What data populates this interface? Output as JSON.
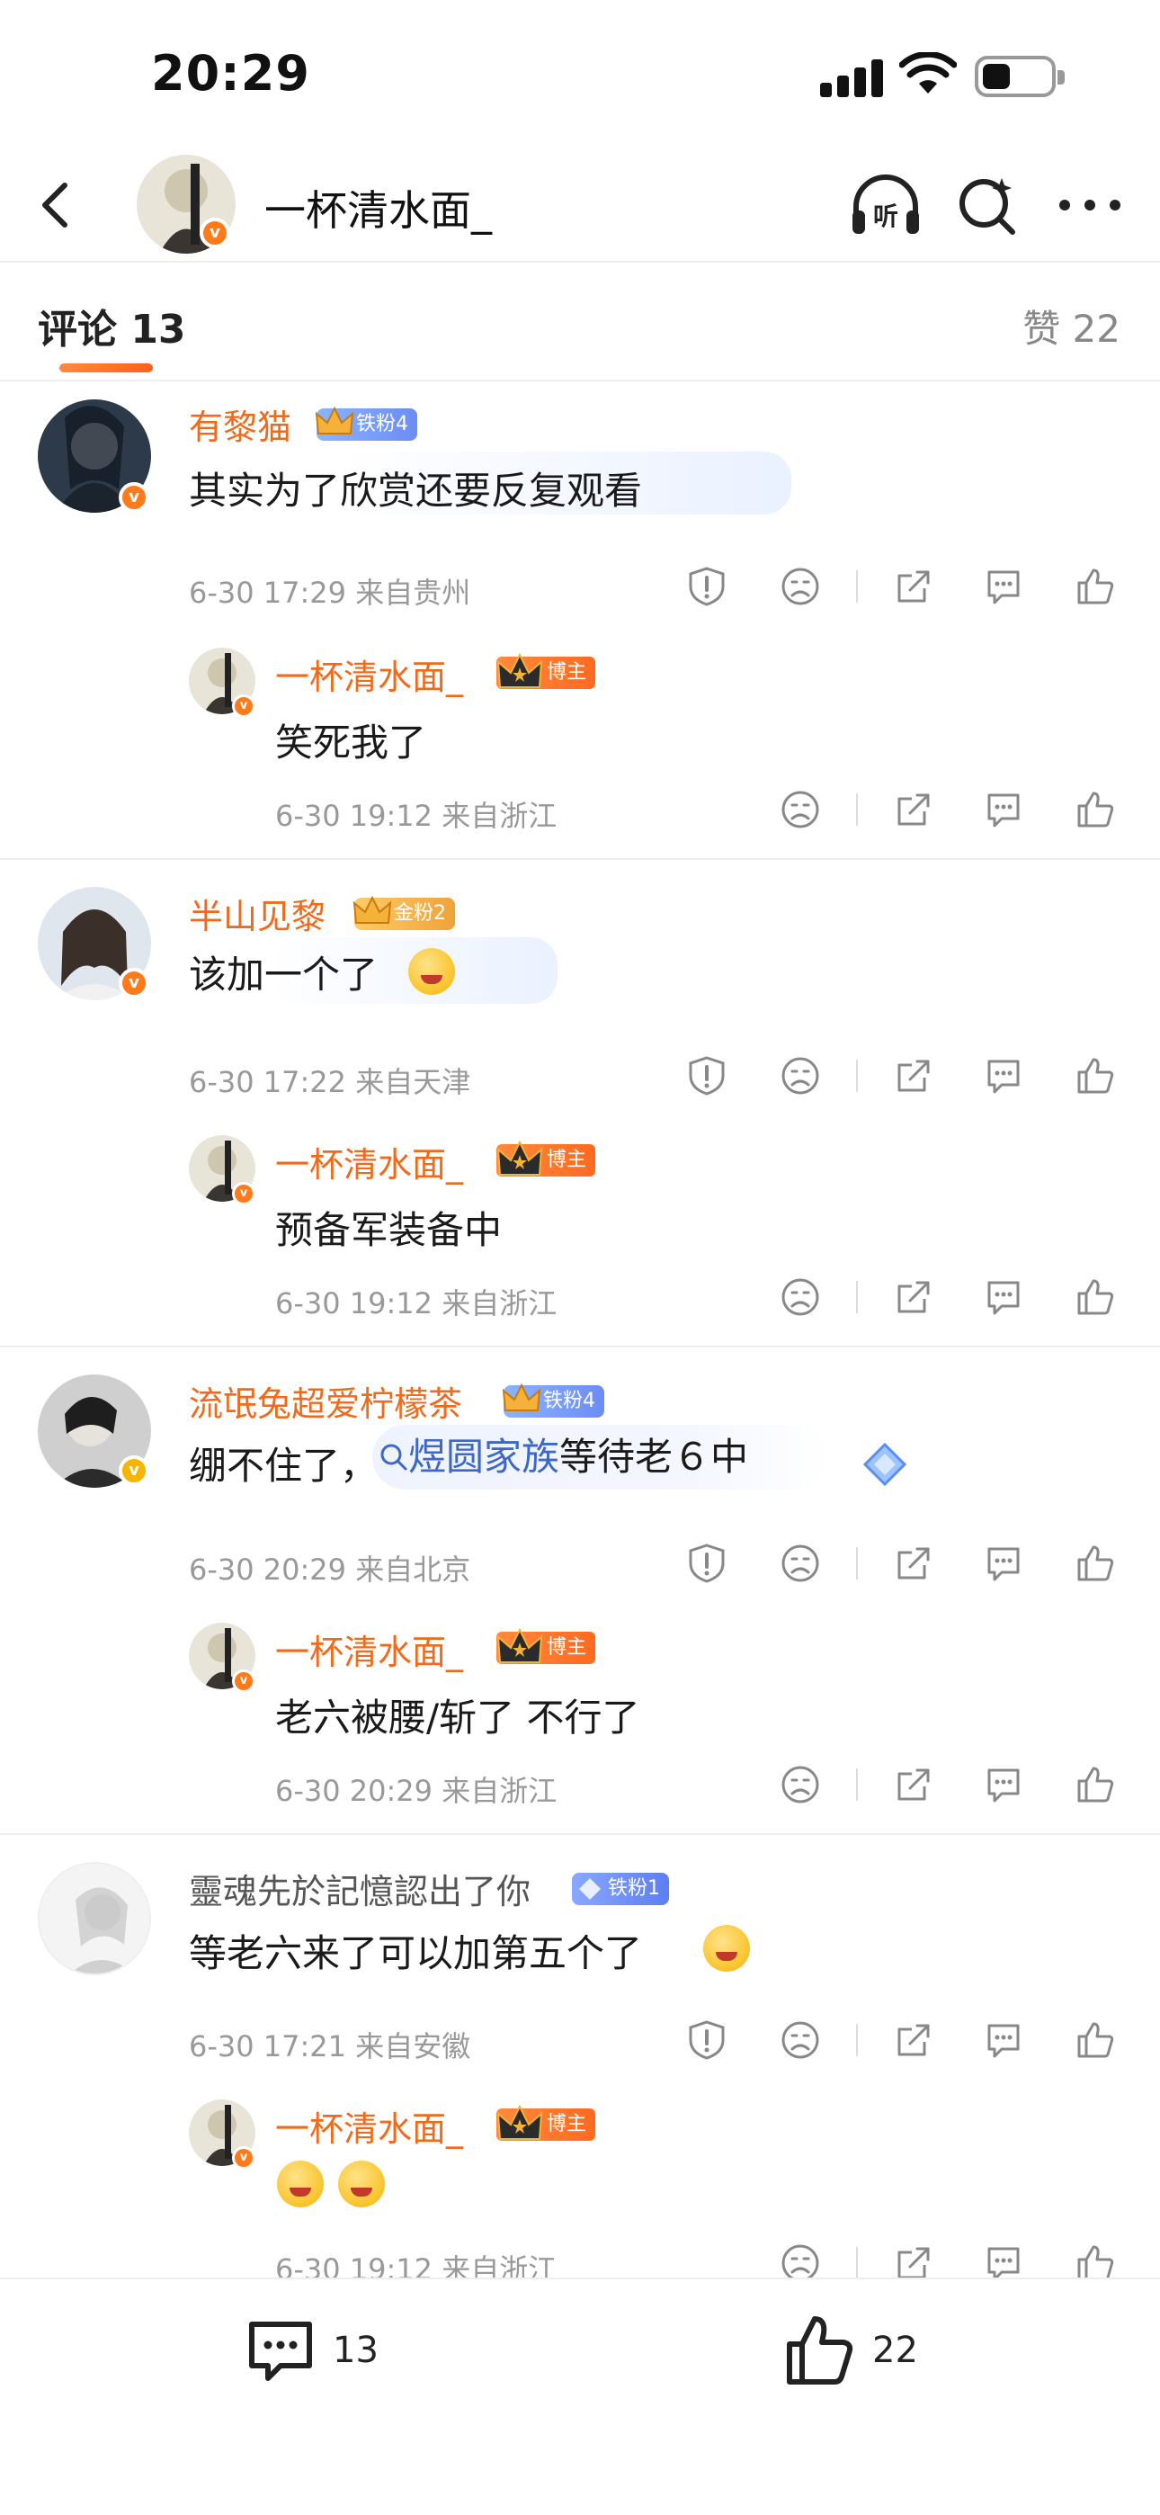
{
  "status_bar": {
    "time": "20:29"
  },
  "header": {
    "title": "一杯清水面_"
  },
  "tabs": {
    "comments_label": "评论 13",
    "likes_label": "赞 22"
  },
  "comments": [
    {
      "user": "有黎猫",
      "fan_badge": "铁粉4",
      "text": "其实为了欣赏还要反复观看",
      "meta": "6-30 17:29  来自贵州",
      "reply": {
        "user": "一杯清水面_",
        "badge": "博主",
        "text": "笑死我了",
        "meta": "6-30 19:12  来自浙江"
      }
    },
    {
      "user": "半山见黎",
      "fan_badge": "金粉2",
      "text": "该加一个了",
      "meta": "6-30 17:22  来自天津",
      "reply": {
        "user": "一杯清水面_",
        "badge": "博主",
        "text": "预备军装备中",
        "meta": "6-30 19:12  来自浙江"
      }
    },
    {
      "user": "流氓兔超爱柠檬茶",
      "fan_badge": "铁粉4",
      "text_prefix": "绷不住了，",
      "topic": "煜圆家族",
      "text_suffix": "等待老６中",
      "meta": "6-30 20:29  来自北京",
      "reply": {
        "user": "一杯清水面_",
        "badge": "博主",
        "text": "老六被腰/斩了 不行了",
        "meta": "6-30 20:29  来自浙江"
      }
    },
    {
      "user": "靈魂先於記憶認出了你",
      "fan_badge": "铁粉1",
      "text": "等老六来了可以加第五个了",
      "meta": "6-30 17:21  来自安徽",
      "reply": {
        "user": "一杯清水面_",
        "badge": "博主",
        "text": "",
        "meta": "6-30 19:12  来自浙江"
      }
    }
  ],
  "bottom_bar": {
    "comment_count": "13",
    "like_count": "22"
  },
  "colors": {
    "accent": "#f06a1c",
    "link": "#3d67c8",
    "meta": "#999999"
  }
}
